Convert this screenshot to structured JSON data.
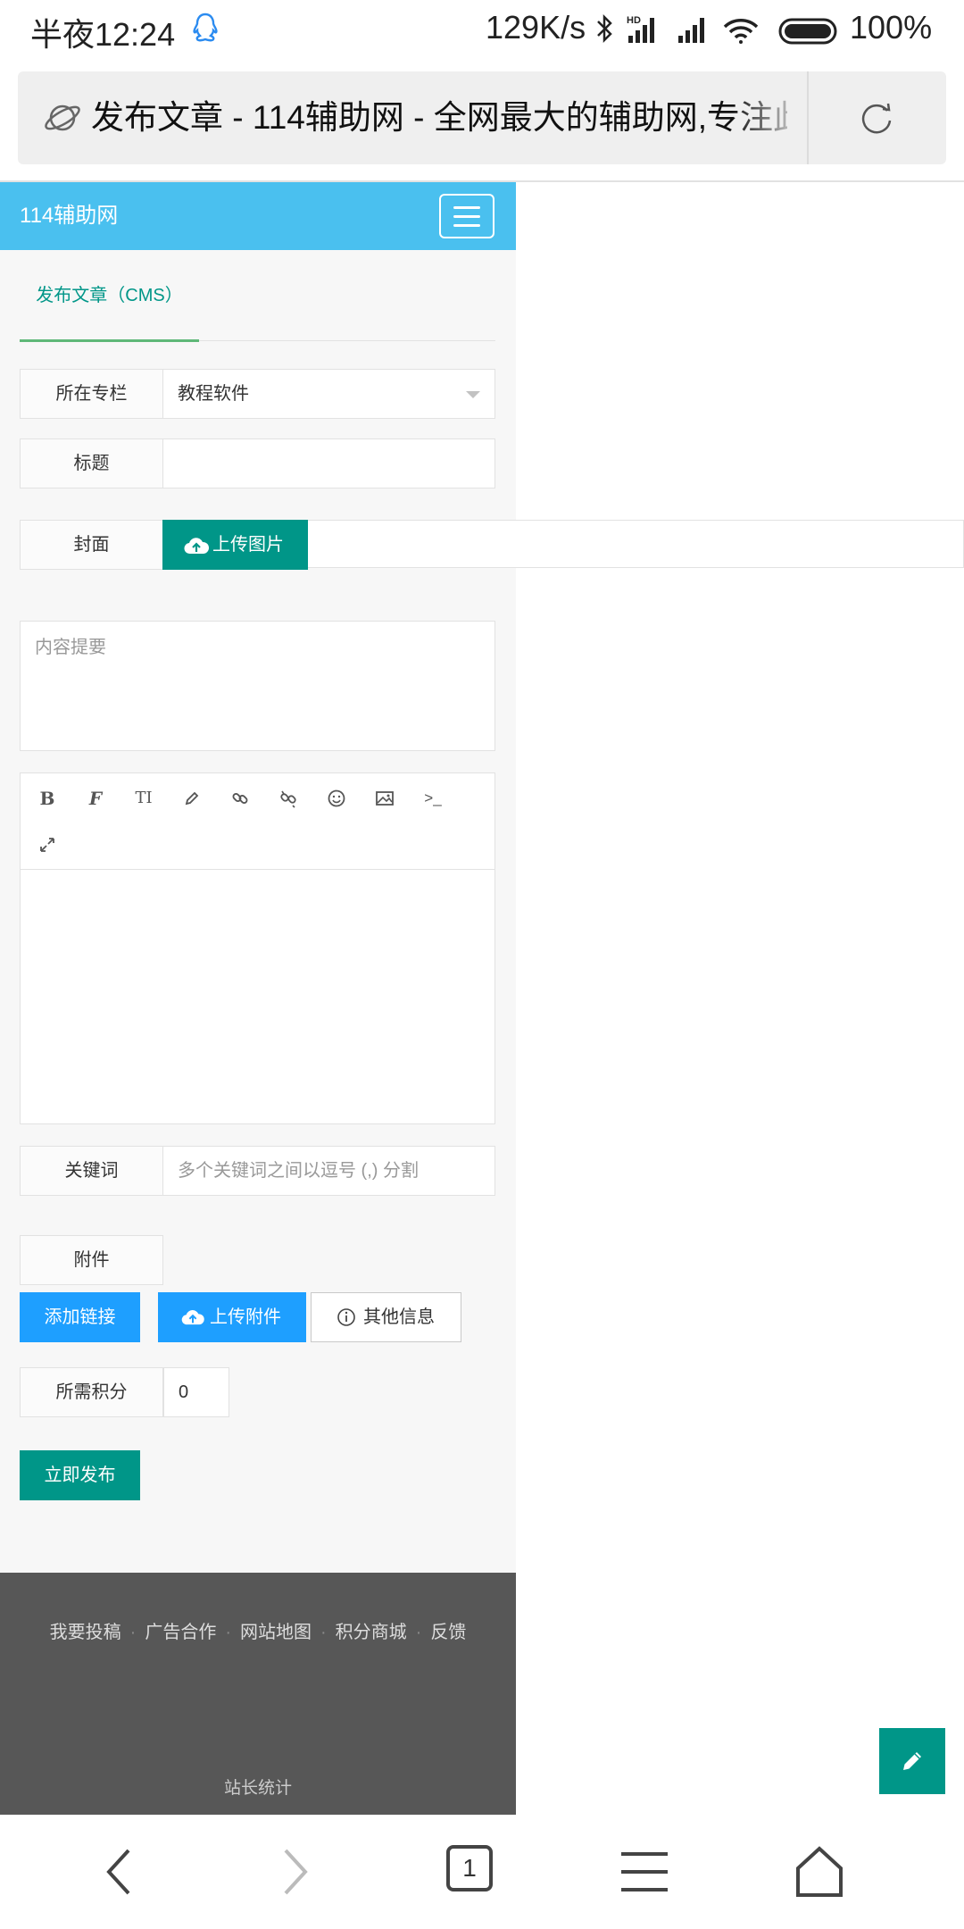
{
  "status_bar": {
    "time": "半夜12:24",
    "net_speed": "129K/s",
    "battery": "100%"
  },
  "address_bar": {
    "title": "发布文章 - 114辅助网 - 全网最大的辅助网,专注此"
  },
  "site": {
    "logo": "114辅助网",
    "tab_label": "发布文章（CMS）",
    "form": {
      "column_label": "所在专栏",
      "column_value": "教程软件",
      "title_label": "标题",
      "title_value": "",
      "cover_label": "封面",
      "upload_image": "上传图片",
      "summary_placeholder": "内容提要",
      "keywords_label": "关键词",
      "keywords_placeholder": "多个关键词之间以逗号 (,) 分割",
      "attachment_label": "附件",
      "add_link": "添加链接",
      "upload_attachment": "上传附件",
      "other_info": "其他信息",
      "points_label": "所需积分",
      "points_value": "0",
      "publish": "立即发布"
    },
    "editor_tools": [
      "bold-icon",
      "italic-icon",
      "text-size-icon",
      "pencil-icon",
      "link-icon",
      "unlink-icon",
      "emoji-icon",
      "image-icon",
      "code-icon",
      "fullscreen-icon"
    ],
    "footer": {
      "links": [
        "我要投稿",
        "广告合作",
        "网站地图",
        "积分商城",
        "反馈"
      ],
      "stats": "站长统计"
    }
  },
  "browser_nav": {
    "tabs_count": "1"
  },
  "colors": {
    "header": "#4ac0ef",
    "primary_green": "#009688",
    "primary_blue": "#1e9fff",
    "footer": "#575757"
  }
}
